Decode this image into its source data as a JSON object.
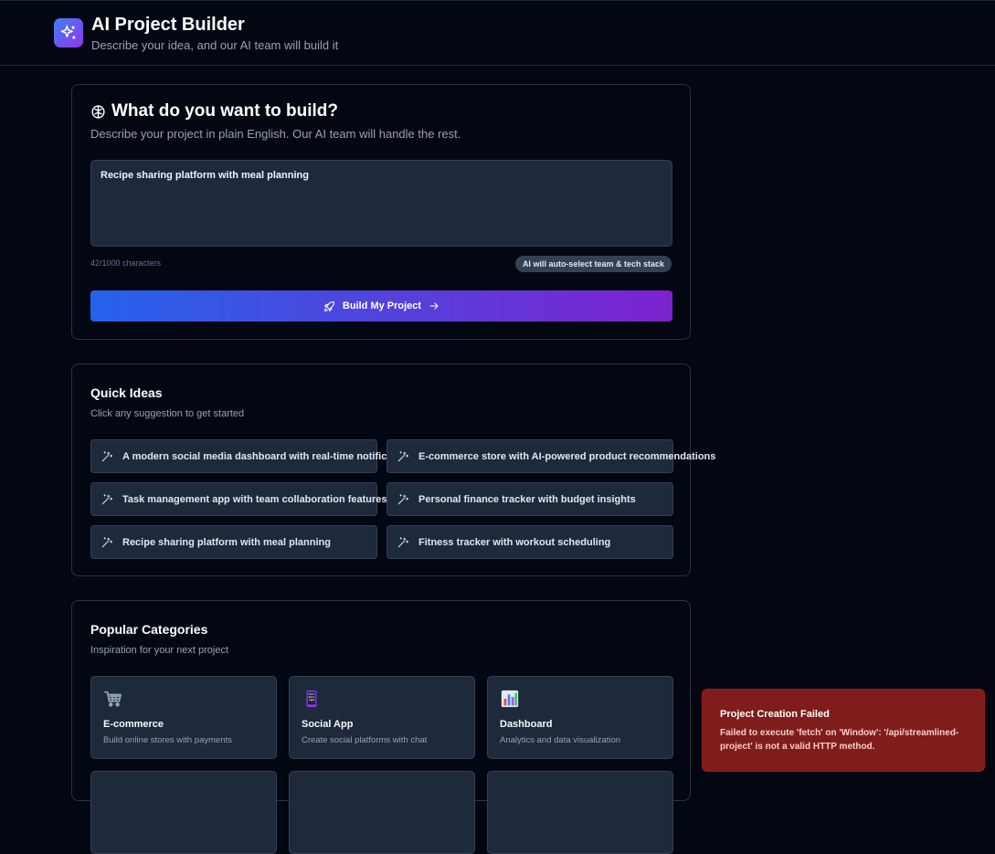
{
  "header": {
    "title": "AI Project Builder",
    "subtitle": "Describe your idea, and our AI team will build it",
    "logo_icon": "sparkles-icon"
  },
  "build": {
    "title": "What do you want to build?",
    "title_icon": "brain-icon",
    "description": "Describe your project in plain English. Our AI team will handle the rest.",
    "prompt_value": "Recipe sharing platform with meal planning",
    "char_count": "42/1000 characters",
    "ai_badge": "AI will auto-select team & tech stack",
    "button_label": "Build My Project",
    "button_icons": [
      "rocket-icon",
      "arrow-right-icon"
    ]
  },
  "quick_ideas": {
    "title": "Quick Ideas",
    "description": "Click any suggestion to get started",
    "item_icon": "magic-wand-icon",
    "items": [
      "A modern social media dashboard with real-time notifications",
      "E-commerce store with AI-powered product recommendations",
      "Task management app with team collaboration features",
      "Personal finance tracker with budget insights",
      "Recipe sharing platform with meal planning",
      "Fitness tracker with workout scheduling"
    ]
  },
  "categories": {
    "title": "Popular Categories",
    "description": "Inspiration for your next project",
    "items": [
      {
        "name": "E-commerce",
        "desc": "Build online stores with payments",
        "icon": "shopping-cart-icon"
      },
      {
        "name": "Social App",
        "desc": "Create social platforms with chat",
        "icon": "mobile-phone-icon"
      },
      {
        "name": "Dashboard",
        "desc": "Analytics and data visualization",
        "icon": "bar-chart-icon"
      }
    ]
  },
  "toast": {
    "title": "Project Creation Failed",
    "message": "Failed to execute 'fetch' on 'Window': '/api/streamlined-project' is not a valid HTTP method."
  },
  "colors": {
    "background": "#030712",
    "card_bg": "#1e293b",
    "accent_start": "#2563eb",
    "accent_end": "#7e22ce",
    "error_bg": "#7f1d1d"
  }
}
